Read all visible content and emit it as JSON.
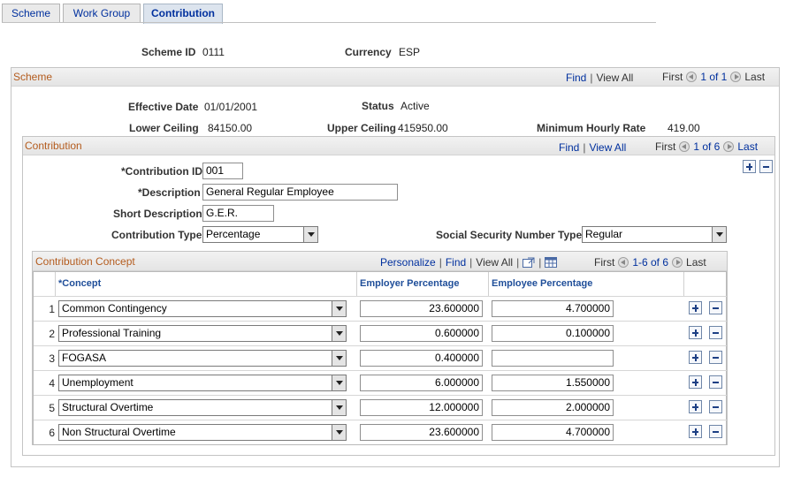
{
  "tabs": [
    {
      "label": "Scheme",
      "active": false
    },
    {
      "label": "Work Group",
      "active": false
    },
    {
      "label": "Contribution",
      "active": true
    }
  ],
  "top": {
    "scheme_id_label": "Scheme ID",
    "scheme_id_value": "0111",
    "currency_label": "Currency",
    "currency_value": "ESP"
  },
  "scheme": {
    "title": "Scheme",
    "find": "Find",
    "view_all": "View All",
    "first": "First",
    "counter": "1 of 1",
    "last": "Last",
    "effective_date_label": "Effective Date",
    "effective_date_value": "01/01/2001",
    "status_label": "Status",
    "status_value": "Active",
    "lower_ceiling_label": "Lower Ceiling",
    "lower_ceiling_value": "84150.00",
    "upper_ceiling_label": "Upper Ceiling",
    "upper_ceiling_value": "415950.00",
    "min_hourly_label": "Minimum Hourly Rate",
    "min_hourly_value": "419.00"
  },
  "contribution": {
    "title": "Contribution",
    "find": "Find",
    "view_all": "View All",
    "first": "First",
    "counter": "1 of 6",
    "last": "Last",
    "id_label": "*Contribution ID",
    "id_value": "001",
    "desc_label": "*Description",
    "desc_value": "General Regular Employee",
    "short_desc_label": "Short Description",
    "short_desc_value": "G.E.R.",
    "type_label": "Contribution Type",
    "type_value": "Percentage",
    "ssn_type_label": "Social Security Number Type",
    "ssn_type_value": "Regular"
  },
  "concept": {
    "title": "Contribution Concept",
    "personalize": "Personalize",
    "find": "Find",
    "view_all": "View All",
    "first": "First",
    "counter": "1-6 of 6",
    "last": "Last",
    "col_concept": "*Concept",
    "col_employer": "Employer Percentage",
    "col_employee": "Employee Percentage",
    "rows": [
      {
        "num": "1",
        "concept": "Common Contingency",
        "employer": "23.600000",
        "employee": "4.700000"
      },
      {
        "num": "2",
        "concept": "Professional Training",
        "employer": "0.600000",
        "employee": "0.100000"
      },
      {
        "num": "3",
        "concept": "FOGASA",
        "employer": "0.400000",
        "employee": ""
      },
      {
        "num": "4",
        "concept": "Unemployment",
        "employer": "6.000000",
        "employee": "1.550000"
      },
      {
        "num": "5",
        "concept": "Structural Overtime",
        "employer": "12.000000",
        "employee": "2.000000"
      },
      {
        "num": "6",
        "concept": "Non Structural Overtime",
        "employer": "23.600000",
        "employee": "4.700000"
      }
    ]
  }
}
